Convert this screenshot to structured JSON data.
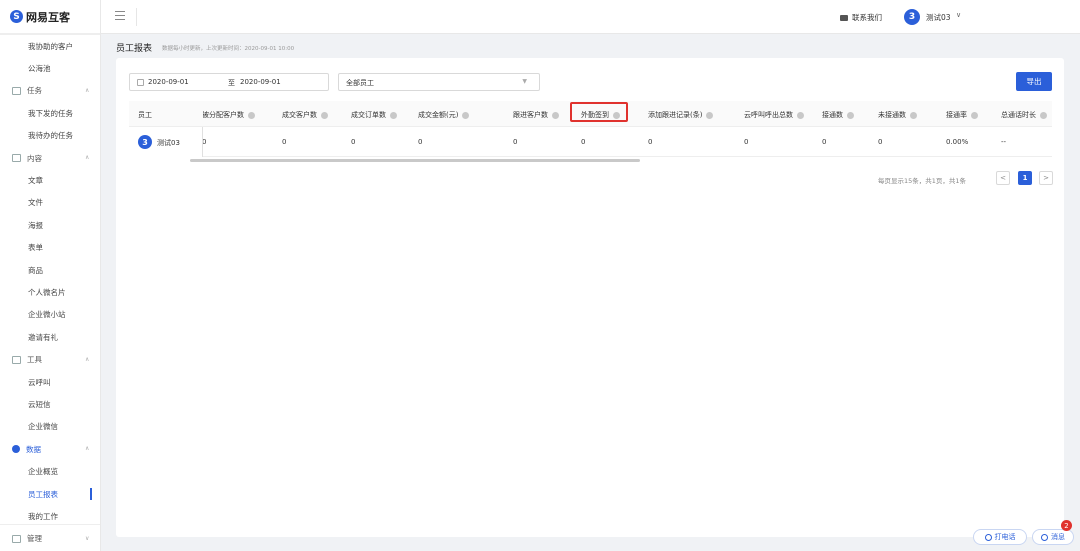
{
  "app": {
    "logo_text": "网易互客",
    "logo_mark": "S"
  },
  "topbar": {
    "contact_label": "联系我们",
    "user_initial": "3",
    "user_name": "测试03",
    "user_chevron": "∨"
  },
  "sidebar": {
    "items": [
      {
        "type": "item",
        "label": "我协助的客户"
      },
      {
        "type": "item",
        "label": "公海池"
      },
      {
        "type": "group",
        "label": "任务"
      },
      {
        "type": "item",
        "label": "我下发的任务"
      },
      {
        "type": "item",
        "label": "我待办的任务"
      },
      {
        "type": "group",
        "label": "内容"
      },
      {
        "type": "item",
        "label": "文章"
      },
      {
        "type": "item",
        "label": "文件"
      },
      {
        "type": "item",
        "label": "海报"
      },
      {
        "type": "item",
        "label": "表单"
      },
      {
        "type": "item",
        "label": "商品"
      },
      {
        "type": "item",
        "label": "个人微名片"
      },
      {
        "type": "item",
        "label": "企业微小站"
      },
      {
        "type": "item",
        "label": "邀请有礼"
      },
      {
        "type": "group",
        "label": "工具"
      },
      {
        "type": "item",
        "label": "云呼叫"
      },
      {
        "type": "item",
        "label": "云短信"
      },
      {
        "type": "item",
        "label": "企业微信"
      },
      {
        "type": "group",
        "label": "数据",
        "active": true
      },
      {
        "type": "item",
        "label": "企业概览"
      },
      {
        "type": "item",
        "label": "员工报表",
        "active": true
      },
      {
        "type": "item",
        "label": "我的工作"
      },
      {
        "type": "group",
        "label": "管理"
      }
    ]
  },
  "page": {
    "title": "员工报表",
    "subtitle": "数据每小时更新，上次更新时间：2020-09-01 10:00"
  },
  "filters": {
    "date_start": "2020-09-01",
    "date_sep": "至",
    "date_end": "2020-09-01",
    "employee_select": "全部员工",
    "export_label": "导出"
  },
  "table": {
    "fixed_header": "员工",
    "columns": [
      "被分配客户数",
      "成交客户数",
      "成交订单数",
      "成交金额(元)",
      "跟进客户数",
      "外勤签到",
      "添加跟进记录(条)",
      "云呼叫呼出总数",
      "接通数",
      "未接通数",
      "接通率",
      "总通话时长"
    ],
    "rows": [
      {
        "initial": "3",
        "name": "测试03",
        "values": [
          "0",
          "0",
          "0",
          "0",
          "0",
          "0",
          "0",
          "0",
          "0",
          "0",
          "0.00%",
          "--"
        ]
      }
    ]
  },
  "pagination": {
    "info": "每页显示15条，共1页，共1条",
    "prev": "<",
    "current": "1",
    "next": ">"
  },
  "float": {
    "call_label": "打电话",
    "msg_label": "消息",
    "msg_count": "2"
  },
  "colors": {
    "accent": "#2b5fd9",
    "highlight": "#e0322e"
  }
}
